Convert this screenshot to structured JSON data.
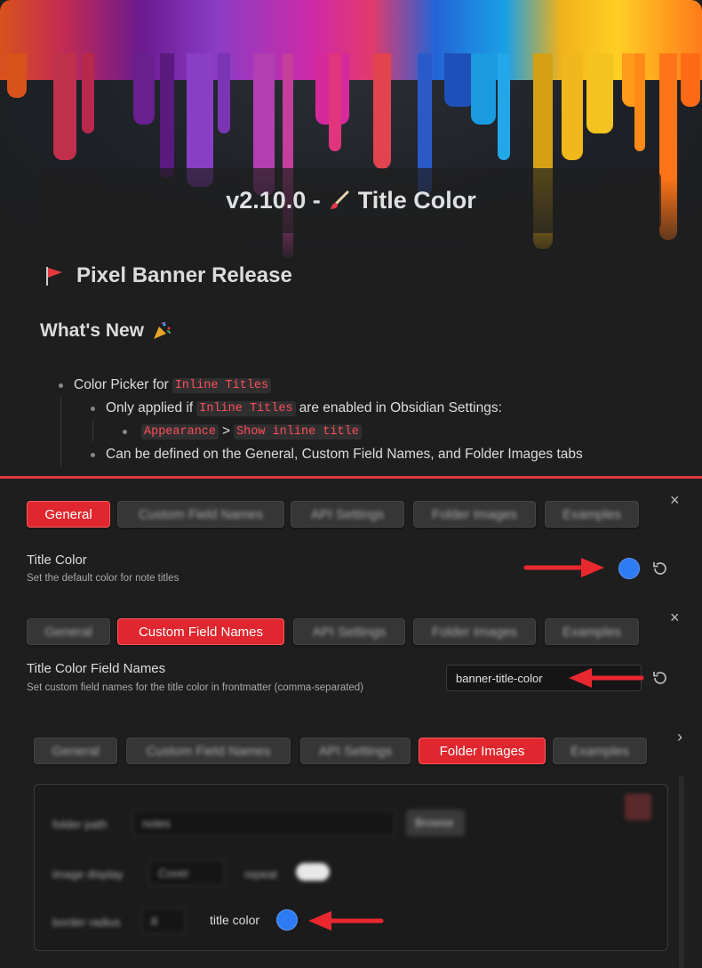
{
  "header": {
    "version_title": "v2.10.0 -",
    "title_suffix": "Title Color"
  },
  "release_heading": "Pixel Banner Release",
  "whats_new": "What's New",
  "list": {
    "item1_prefix": "Color Picker for",
    "item1_code": "Inline Titles",
    "sub1_prefix": "Only applied if",
    "sub1_code": "Inline Titles",
    "sub1_suffix": "are enabled in Obsidian Settings:",
    "subsub_code1": "Appearance",
    "subsub_sep": ">",
    "subsub_code2": "Show inline title",
    "sub2": "Can be defined on the General, Custom Field Names, and Folder Images tabs"
  },
  "panel1": {
    "tabs": [
      "General",
      "Custom Field Names",
      "API Settings",
      "Folder Images",
      "Examples"
    ],
    "active": "General",
    "setting_name": "Title Color",
    "setting_desc": "Set the default color for note titles",
    "close": "×"
  },
  "panel2": {
    "tabs": [
      "General",
      "Custom Field Names",
      "API Settings",
      "Folder Images",
      "Examples"
    ],
    "active": "Custom Field Names",
    "setting_name": "Title Color Field Names",
    "setting_desc": "Set custom field names for the title color in frontmatter (comma-separated)",
    "input_value": "banner-title-color",
    "close": "×"
  },
  "panel3": {
    "tabs": [
      "General",
      "Custom Field Names",
      "API Settings",
      "Folder Images",
      "Examples"
    ],
    "active": "Folder Images",
    "folder_path_label": "folder path",
    "folder_path_value": "notes",
    "browse": "Browse",
    "image_display_label": "image display",
    "image_display_value": "Cover",
    "repeat_label": "repeat",
    "border_radius_label": "border radius",
    "border_radius_value": "8",
    "title_color_label": "title color",
    "close": "›"
  },
  "colors": {
    "accent_red": "#e0262e",
    "picker_blue": "#2f7bf5",
    "code_red": "#ff4d5a"
  }
}
